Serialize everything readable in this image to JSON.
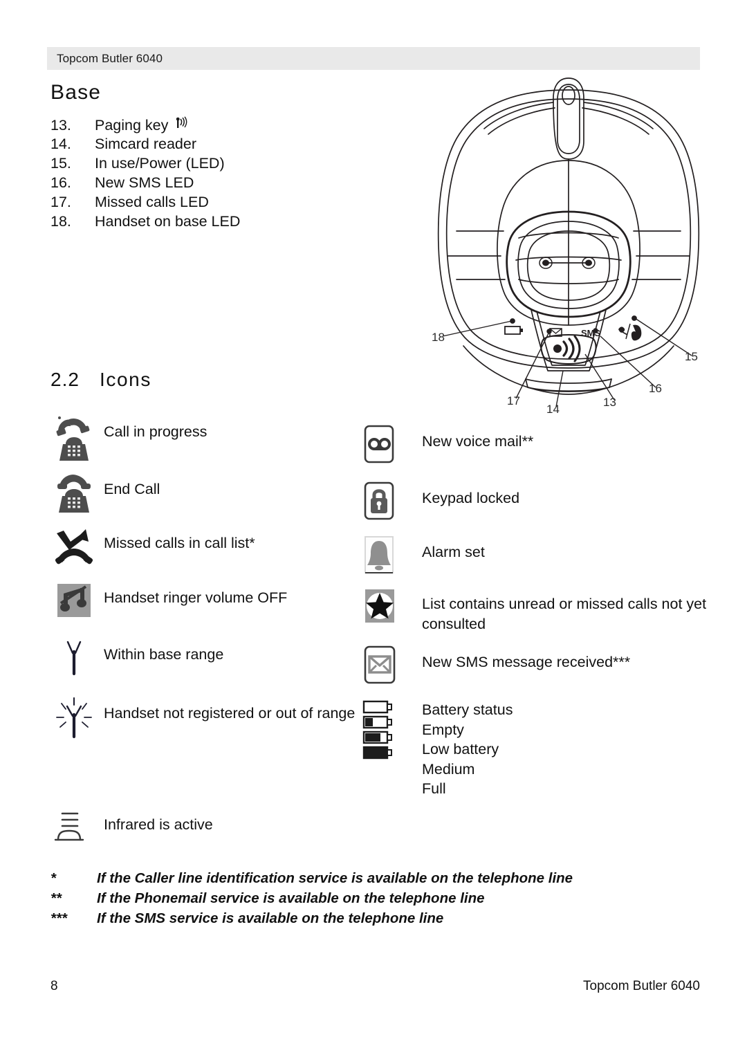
{
  "header": {
    "running_title": "Topcom Butler 6040"
  },
  "headings": {
    "base": "Base",
    "icons_number": "2.2",
    "icons_title": "Icons"
  },
  "part_list": [
    {
      "num": "13.",
      "label": "Paging key",
      "icon": "paging-key-icon"
    },
    {
      "num": "14.",
      "label": "Simcard reader",
      "icon": null
    },
    {
      "num": "15.",
      "label": "In use/Power (LED)",
      "icon": null
    },
    {
      "num": "16.",
      "label": "New SMS LED",
      "icon": null
    },
    {
      "num": "17.",
      "label": "Missed calls LED",
      "icon": null
    },
    {
      "num": "18.",
      "label": "Handset on base LED",
      "icon": null
    }
  ],
  "diagram": {
    "title": "base-station-top-view",
    "callouts": [
      {
        "id": "18",
        "label": "18"
      },
      {
        "id": "15",
        "label": "15"
      },
      {
        "id": "16",
        "label": "16"
      },
      {
        "id": "17",
        "label": "17"
      },
      {
        "id": "14",
        "label": "14"
      },
      {
        "id": "13",
        "label": "13"
      }
    ],
    "marking_sms": "SMS"
  },
  "icons_left": [
    {
      "icon": "call-in-progress-icon",
      "label": "Call in progress"
    },
    {
      "icon": "end-call-icon",
      "label": "End Call"
    },
    {
      "icon": "missed-calls-icon",
      "label": "Missed calls in call list*"
    },
    {
      "icon": "ringer-off-icon",
      "label": "Handset ringer volume OFF"
    },
    {
      "icon": "within-range-icon",
      "label": "Within base range"
    },
    {
      "icon": "out-of-range-icon",
      "label": "Handset not registered or out of range"
    },
    {
      "icon": "infrared-icon",
      "label": "Infrared is active"
    }
  ],
  "icons_right": [
    {
      "icon": "voice-mail-icon",
      "label": "New voice mail**"
    },
    {
      "icon": "keypad-lock-icon",
      "label": "Keypad locked"
    },
    {
      "icon": "alarm-bell-icon",
      "label": "Alarm set"
    },
    {
      "icon": "star-unread-icon",
      "label": "List contains unread or missed calls not yet consulted"
    },
    {
      "icon": "sms-envelope-icon",
      "label": "New SMS message received***"
    }
  ],
  "battery": {
    "icon": "battery-status-icon",
    "lines": [
      "Battery status",
      "Empty",
      "Low battery",
      "Medium",
      "Full"
    ]
  },
  "footnotes": [
    {
      "mark": "*",
      "text": "If the Caller line identification service is available on the telephone line"
    },
    {
      "mark": "**",
      "text": "If the Phonemail service is available on the telephone line"
    },
    {
      "mark": "***",
      "text": "If the SMS service is available on the telephone line"
    }
  ],
  "footer": {
    "page_number": "8",
    "model": "Topcom Butler 6040"
  },
  "colors": {
    "header_band": "#e9e9e9",
    "text": "#111111",
    "icon_dark": "#4a4a4a",
    "icon_gray": "#9a9a9a"
  }
}
